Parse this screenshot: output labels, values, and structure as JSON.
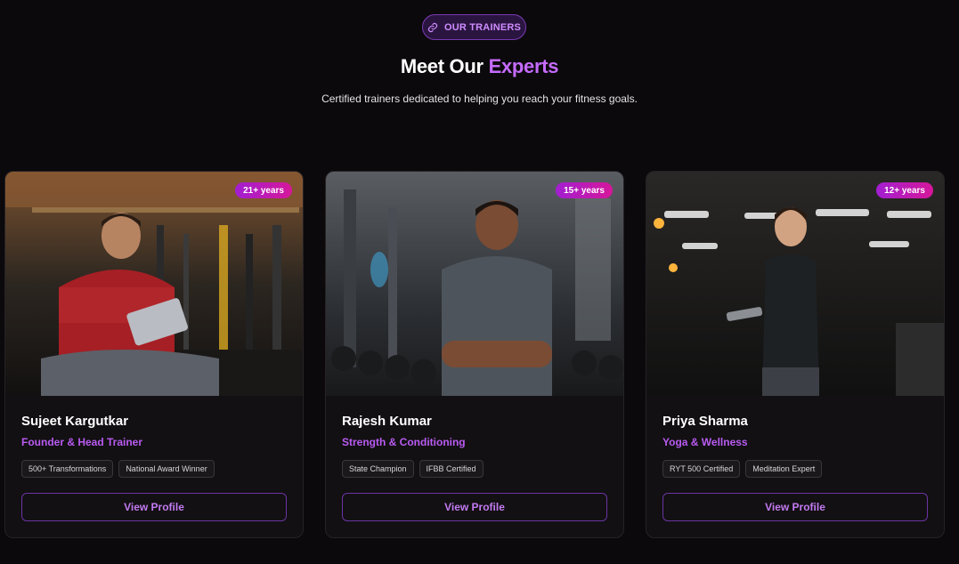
{
  "header": {
    "badge_label": "OUR TRAINERS",
    "title_main": "Meet Our ",
    "title_accent": "Experts",
    "subtitle": "Certified trainers dedicated to helping you reach your fitness goals."
  },
  "trainers": [
    {
      "years": "21+ years",
      "name": "Sujeet Kargutkar",
      "role": "Founder & Head Trainer",
      "tags": [
        "500+ Transformations",
        "National Award Winner"
      ],
      "button": "View Profile"
    },
    {
      "years": "15+ years",
      "name": "Rajesh Kumar",
      "role": "Strength & Conditioning",
      "tags": [
        "State Champion",
        "IFBB Certified"
      ],
      "button": "View Profile"
    },
    {
      "years": "12+ years",
      "name": "Priya Sharma",
      "role": "Yoga & Wellness",
      "tags": [
        "RYT 500 Certified",
        "Meditation Expert"
      ],
      "button": "View Profile"
    }
  ],
  "colors": {
    "background": "#0b090b",
    "accent": "#c56bff",
    "badge_gradient_start": "#a21fd1",
    "badge_gradient_end": "#d6179a"
  }
}
